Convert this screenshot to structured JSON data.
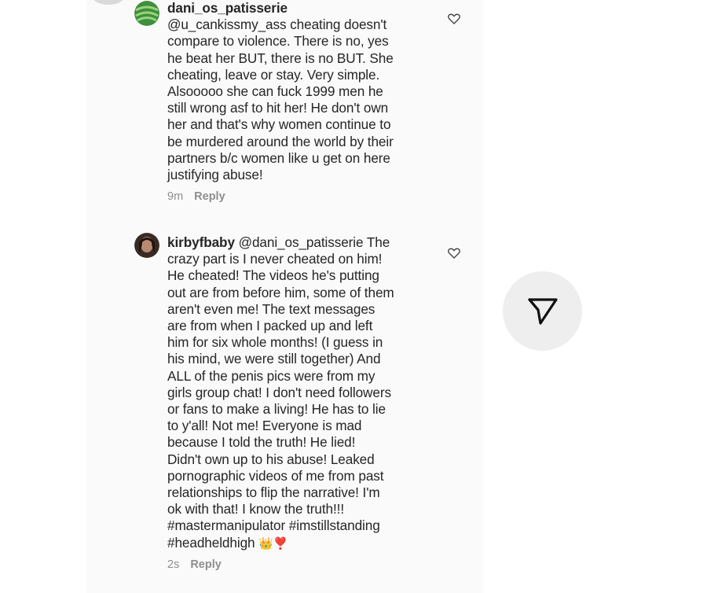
{
  "comments": [
    {
      "username": "dani_os_patisserie",
      "lines": [
        "@u_cankissmy_ass cheating doesn't",
        "compare to violence. There is no, yes",
        "he beat her BUT, there is no BUT. She",
        "cheating, leave or stay. Very simple.",
        "Alsooooo she can fuck 1999 men he",
        "still wrong asf to hit her! He don't own",
        "her and that's why women continue to",
        "be murdered around the world by their",
        "partners b/c women like u get on here",
        "justifying abuse!"
      ],
      "time": "9m",
      "reply_label": "Reply"
    },
    {
      "username": "kirbyfbaby",
      "first_line_rest": "@dani_os_patisserie The",
      "lines": [
        "crazy part is I never cheated on him!",
        "He cheated! The videos he's putting",
        "out are from before him, some of them",
        "aren't even me! The text messages",
        "are from when I packed up and left",
        "him for six whole months! (I guess in",
        "his mind, we were still together) And",
        "ALL of the penis pics were from my",
        "girls group chat! I don't need followers",
        "or fans to make a living! He has to lie",
        "to y'all! Not me! Everyone is mad",
        "because I told the truth! He lied!",
        "Didn't own up to his abuse! Leaked",
        "pornographic videos of me from past",
        "relationships to flip the narrative! I'm",
        "ok with that! I know the truth!!!",
        "#mastermanipulator #imstillstanding"
      ],
      "last_line": "#headheldhigh",
      "last_line_emoji": "👑❣️",
      "time": "2s",
      "reply_label": "Reply"
    }
  ],
  "icons": {
    "like": "heart-outline-icon",
    "share": "paper-plane-icon"
  }
}
